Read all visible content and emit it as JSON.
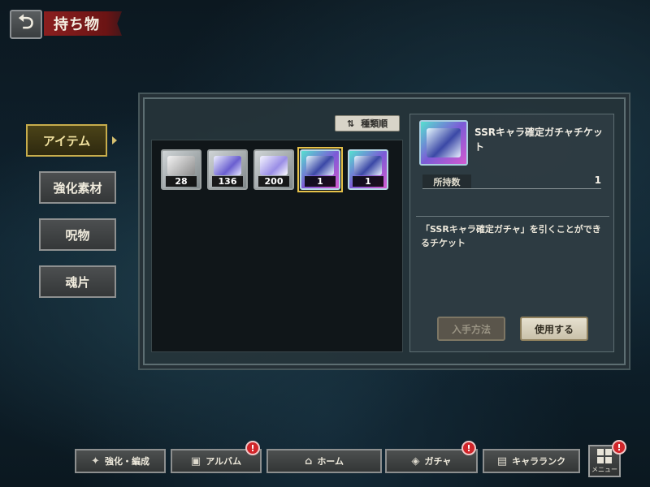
{
  "header": {
    "back_icon": "back-arrow-icon",
    "title": "持ち物"
  },
  "tabs": [
    {
      "label": "アイテム",
      "active": true
    },
    {
      "label": "強化素材",
      "active": false
    },
    {
      "label": "呪物",
      "active": false
    },
    {
      "label": "魂片",
      "active": false
    }
  ],
  "sort": {
    "icon": "sort-icon",
    "label": "種類順"
  },
  "items": [
    {
      "icon": "silver-ticket-icon",
      "count": "28"
    },
    {
      "icon": "crystal-shard-icon",
      "count": "136"
    },
    {
      "icon": "dice-cube-icon",
      "count": "200"
    },
    {
      "icon": "ssr-ticket-icon",
      "count": "1",
      "selected": true
    },
    {
      "icon": "rainbow-ticket-icon",
      "count": "1"
    }
  ],
  "detail": {
    "icon": "ssr-ticket-icon",
    "name": "SSRキャラ確定ガチャチケット",
    "owned_label": "所持数",
    "owned_value": "1",
    "description": "「SSRキャラ確定ガチャ」を引くことができるチケット",
    "acquire_label": "入手方法",
    "use_label": "使用する"
  },
  "bottom_nav": [
    {
      "label": "強化・編成",
      "icon": "people-icon",
      "badge": false
    },
    {
      "label": "アルバム",
      "icon": "album-icon",
      "badge": true
    },
    {
      "label": "ホーム",
      "icon": "home-icon",
      "badge": false
    },
    {
      "label": "ガチャ",
      "icon": "gacha-icon",
      "badge": true
    },
    {
      "label": "キャラランク",
      "icon": "character-rank-icon",
      "badge": false
    }
  ],
  "menu": {
    "label": "メニュー",
    "badge": true
  },
  "badge_text": "!"
}
